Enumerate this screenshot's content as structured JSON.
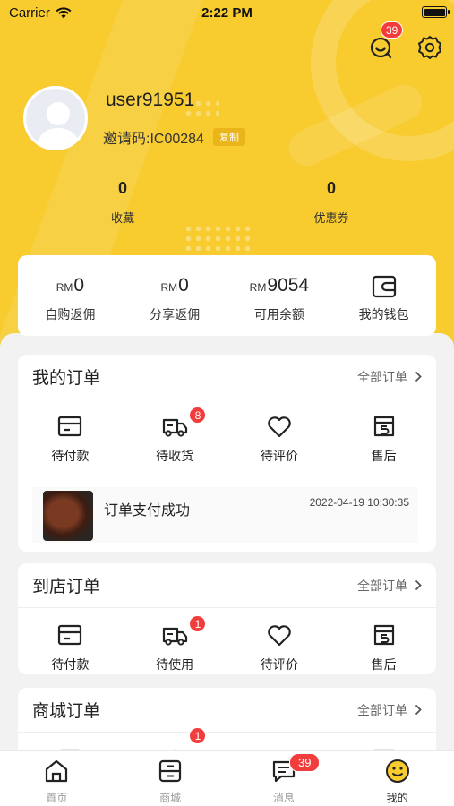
{
  "status_bar": {
    "carrier": "Carrier",
    "time": "2:22 PM"
  },
  "header": {
    "message_badge": "39"
  },
  "profile": {
    "username": "user91951",
    "invite_code": "邀请码:IC00284",
    "copy_label": "复制"
  },
  "stats": [
    {
      "value": "0",
      "label": "收藏"
    },
    {
      "value": "0",
      "label": "优惠券"
    }
  ],
  "wallet": {
    "currency": "RM",
    "items": [
      {
        "amount": "0",
        "label": "自购返佣"
      },
      {
        "amount": "0",
        "label": "分享返佣"
      },
      {
        "amount": "9054",
        "label": "可用余额"
      },
      {
        "label": "我的钱包"
      }
    ]
  },
  "my_orders": {
    "title": "我的订单",
    "more": "全部订单",
    "items": [
      {
        "label": "待付款",
        "icon": "card-icon"
      },
      {
        "label": "待收货",
        "icon": "truck-icon",
        "badge": "8"
      },
      {
        "label": "待评价",
        "icon": "heart-icon"
      },
      {
        "label": "售后",
        "icon": "after-sale-icon"
      }
    ],
    "notice": {
      "text": "订单支付成功",
      "time": "2022-04-19 10:30:35"
    }
  },
  "store_orders": {
    "title": "到店订单",
    "more": "全部订单",
    "items": [
      {
        "label": "待付款",
        "icon": "card-icon"
      },
      {
        "label": "待使用",
        "icon": "truck-icon",
        "badge": "1"
      },
      {
        "label": "待评价",
        "icon": "heart-icon"
      },
      {
        "label": "售后",
        "icon": "after-sale-icon"
      }
    ]
  },
  "mall_orders": {
    "title": "商城订单",
    "more": "全部订单",
    "badge": "1"
  },
  "tabbar": [
    {
      "label": "首页",
      "icon": "home-icon"
    },
    {
      "label": "商城",
      "icon": "mall-icon"
    },
    {
      "label": "消息",
      "icon": "message-icon",
      "badge": "39"
    },
    {
      "label": "我的",
      "icon": "smile-icon",
      "active": true
    }
  ],
  "colors": {
    "brand_yellow": "#f8cb2f",
    "badge_red": "#f23d3d"
  }
}
